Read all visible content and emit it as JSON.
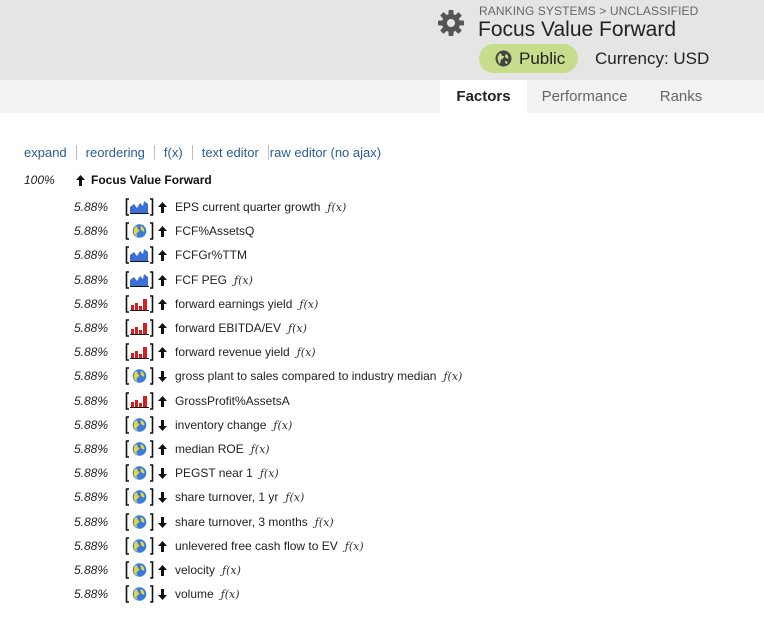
{
  "header": {
    "breadcrumb": "RANKING SYSTEMS > UNCLASSIFIED",
    "title": "Focus Value Forward",
    "visibility": "Public",
    "currency": "Currency: USD",
    "colors": {
      "header_bg": "#e5e5e5",
      "badge_bg": "#c7dd8c",
      "link": "#2a5c96"
    }
  },
  "tabs": [
    {
      "label": "Factors",
      "active": true
    },
    {
      "label": "Performance",
      "active": false
    },
    {
      "label": "Ranks",
      "active": false
    }
  ],
  "toolbar": {
    "expand": "expand",
    "reordering": "reordering",
    "fx": "f(x)",
    "text_editor": "text editor",
    "raw_editor": "raw editor (no ajax)"
  },
  "root": {
    "weight": "100%",
    "direction": "up",
    "name": "Focus Value Forward"
  },
  "factor_icons": {
    "blue-chart": "stock formula node icon (blue area chart)",
    "red-chart": "stock factor node icon (red bar chart)",
    "globe": "function node icon (globe)"
  },
  "factors": [
    {
      "weight": "5.88%",
      "icon": "blue-chart",
      "direction": "up",
      "name": "EPS current quarter growth",
      "fx": "ƒ(x)"
    },
    {
      "weight": "5.88%",
      "icon": "globe",
      "direction": "up",
      "name": "FCF%AssetsQ",
      "fx": ""
    },
    {
      "weight": "5.88%",
      "icon": "blue-chart",
      "direction": "up",
      "name": "FCFGr%TTM",
      "fx": ""
    },
    {
      "weight": "5.88%",
      "icon": "blue-chart",
      "direction": "up",
      "name": "FCF PEG",
      "fx": "ƒ(x)"
    },
    {
      "weight": "5.88%",
      "icon": "red-chart",
      "direction": "up",
      "name": "forward earnings yield",
      "fx": "ƒ(x)"
    },
    {
      "weight": "5.88%",
      "icon": "red-chart",
      "direction": "up",
      "name": "forward EBITDA/EV",
      "fx": "ƒ(x)"
    },
    {
      "weight": "5.88%",
      "icon": "red-chart",
      "direction": "up",
      "name": "forward revenue yield",
      "fx": "ƒ(x)"
    },
    {
      "weight": "5.88%",
      "icon": "globe",
      "direction": "down",
      "name": "gross plant to sales compared to industry median",
      "fx": "ƒ(x)"
    },
    {
      "weight": "5.88%",
      "icon": "red-chart",
      "direction": "up",
      "name": "GrossProfit%AssetsA",
      "fx": ""
    },
    {
      "weight": "5.88%",
      "icon": "globe",
      "direction": "down",
      "name": "inventory change",
      "fx": "ƒ(x)"
    },
    {
      "weight": "5.88%",
      "icon": "globe",
      "direction": "up",
      "name": "median ROE",
      "fx": "ƒ(x)"
    },
    {
      "weight": "5.88%",
      "icon": "globe",
      "direction": "down",
      "name": "PEGST near 1",
      "fx": "ƒ(x)"
    },
    {
      "weight": "5.88%",
      "icon": "globe",
      "direction": "down",
      "name": "share turnover, 1 yr",
      "fx": "ƒ(x)"
    },
    {
      "weight": "5.88%",
      "icon": "globe",
      "direction": "down",
      "name": "share turnover, 3 months",
      "fx": "ƒ(x)"
    },
    {
      "weight": "5.88%",
      "icon": "globe",
      "direction": "up",
      "name": "unlevered free cash flow to EV",
      "fx": "ƒ(x)"
    },
    {
      "weight": "5.88%",
      "icon": "globe",
      "direction": "up",
      "name": "velocity",
      "fx": "ƒ(x)"
    },
    {
      "weight": "5.88%",
      "icon": "globe",
      "direction": "down",
      "name": "volume",
      "fx": "ƒ(x)"
    }
  ]
}
